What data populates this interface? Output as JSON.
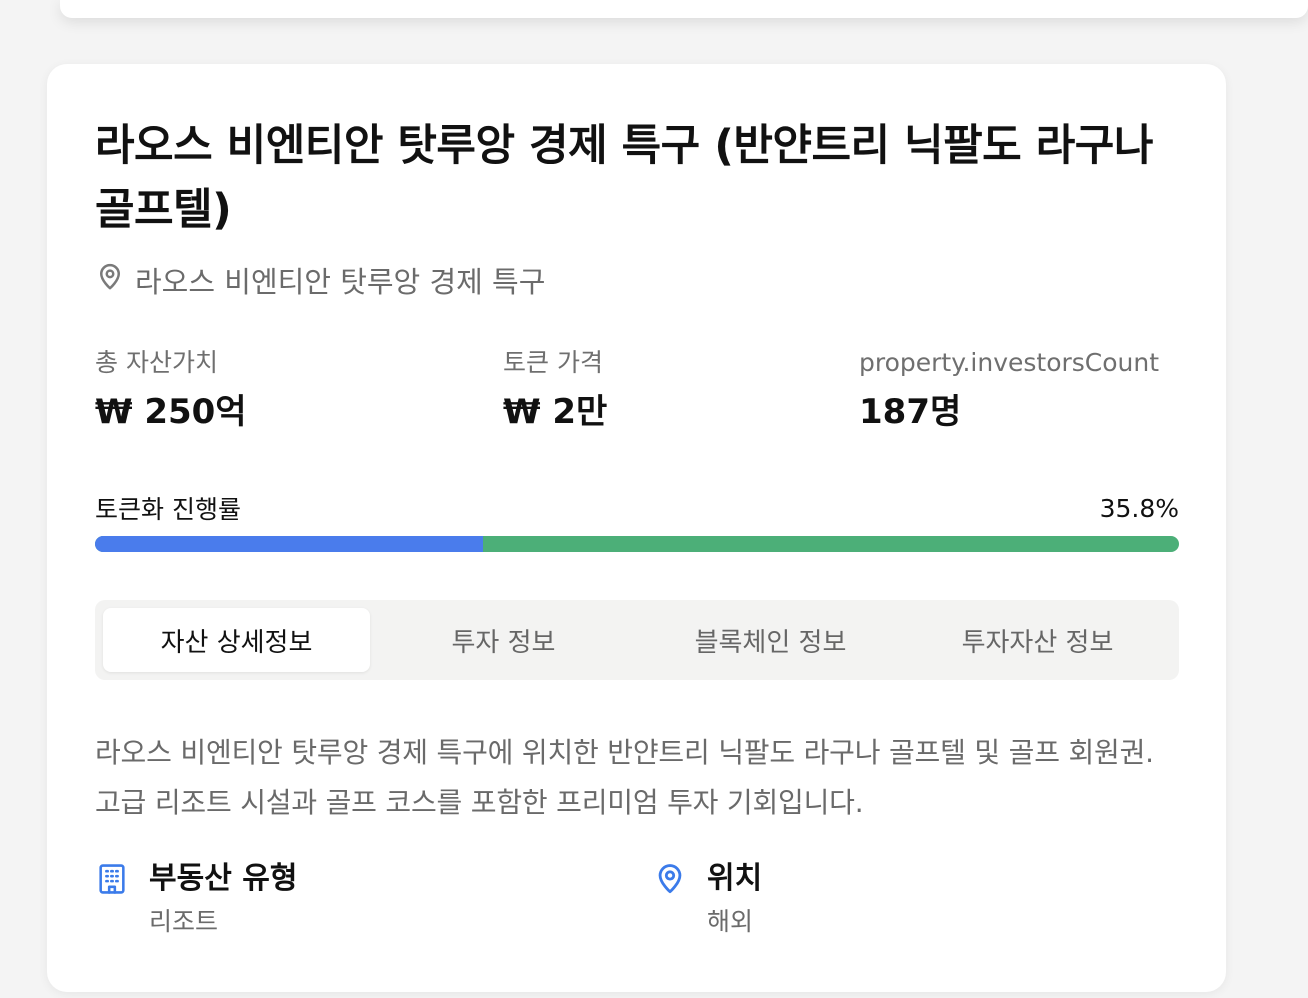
{
  "property": {
    "title": "라오스 비엔티안 탓루앙 경제 특구 (반얀트리 닉팔도 라구나 골프텔)",
    "location": "라오스 비엔티안 탓루앙 경제 특구",
    "stats": {
      "total_value_label": "총 자산가치",
      "total_value": "₩ 250억",
      "token_price_label": "토큰 가격",
      "token_price": "₩ 2만",
      "investors_label": "property.investorsCount",
      "investors_value": "187명"
    },
    "progress": {
      "label": "토큰화 진행률",
      "percent_text": "35.8%",
      "fraction": 0.358
    },
    "tabs": [
      {
        "label": "자산 상세정보",
        "active": true
      },
      {
        "label": "투자 정보",
        "active": false
      },
      {
        "label": "블록체인 정보",
        "active": false
      },
      {
        "label": "투자자산 정보",
        "active": false
      }
    ],
    "description": "라오스 비엔티안 탓루앙 경제 특구에 위치한 반얀트리 닉팔도 라구나 골프텔 및 골프 회원권. 고급 리조트 시설과 골프 코스를 포함한 프리미엄 투자 기회입니다.",
    "details": {
      "type_title": "부동산 유형",
      "type_value": "리조트",
      "location_title": "위치",
      "location_value": "해외"
    }
  },
  "colors": {
    "accent_blue": "#4a7cec",
    "progress_green": "#4caf78",
    "icon_blue": "#3b7bea"
  },
  "icons": {
    "location": "map-pin-icon",
    "type": "building-icon"
  }
}
